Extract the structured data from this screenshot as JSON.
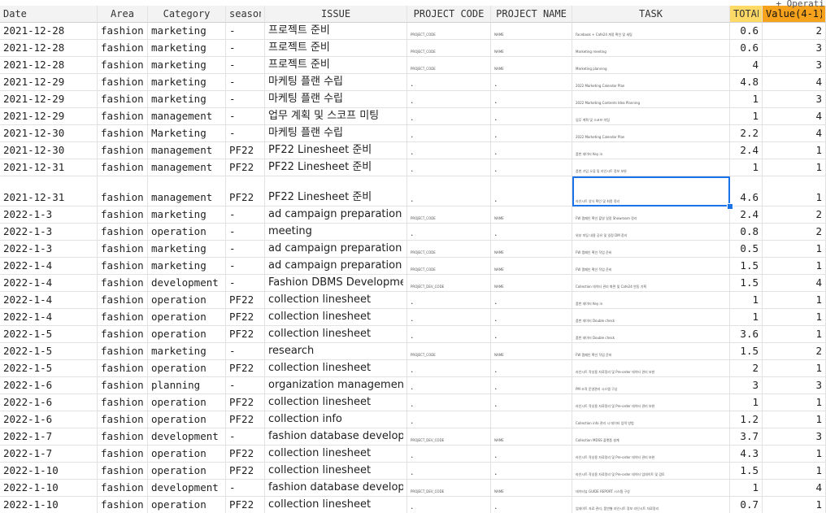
{
  "header": {
    "date": "Date",
    "area": "Area",
    "category": "Category",
    "season": "season",
    "issue": "ISSUE",
    "project_code": "PROJECT CODE",
    "project_name": "PROJECT NAME",
    "task": "TASK",
    "total": "TOTAL",
    "value": "Value(4-1)",
    "overflow": "+ Operati"
  },
  "rows": [
    {
      "date": "2021-12-28",
      "area": "fashion",
      "category": "marketing",
      "season": "-",
      "issue": "프로젝트 준비",
      "code": "PROJECT_CODE",
      "name": "NAME",
      "task": "Facebook + Cafe24 계정 확인 및 세팅",
      "total": "0.6",
      "value": "2"
    },
    {
      "date": "2021-12-28",
      "area": "fashion",
      "category": "marketing",
      "season": "-",
      "issue": "프로젝트 준비",
      "code": "PROJECT_CODE",
      "name": "NAME",
      "task": "Marketing meeting",
      "total": "0.6",
      "value": "3"
    },
    {
      "date": "2021-12-28",
      "area": "fashion",
      "category": "marketing",
      "season": "-",
      "issue": "프로젝트 준비",
      "code": "PROJECT_CODE",
      "name": "NAME",
      "task": "Marketing planning",
      "total": "4",
      "value": "3"
    },
    {
      "date": "2021-12-29",
      "area": "fashion",
      "category": "marketing",
      "season": "-",
      "issue": "마케팅 플랜 수립",
      "code": ".",
      "name": ".",
      "task": "2022 Marketing Calendar Plan",
      "total": "4.8",
      "value": "4"
    },
    {
      "date": "2021-12-29",
      "area": "fashion",
      "category": "marketing",
      "season": "-",
      "issue": "마케팅 플랜 수립",
      "code": ".",
      "name": ".",
      "task": "2022 Marketing Contents Idea Planning",
      "total": "1",
      "value": "3"
    },
    {
      "date": "2021-12-29",
      "area": "fashion",
      "category": "management",
      "season": "-",
      "issue": "업무 계획 및 스코프 미팅",
      "code": ".",
      "name": ".",
      "task": "업무 계획 및 스코프 미팅",
      "total": "1",
      "value": "4"
    },
    {
      "date": "2021-12-30",
      "area": "fashion",
      "category": "Marketing",
      "season": "-",
      "issue": "마케팅 플랜 수립",
      "code": ".",
      "name": ".",
      "task": "2022 Marketing Calendar Plan",
      "total": "2.2",
      "value": "4"
    },
    {
      "date": "2021-12-30",
      "area": "fashion",
      "category": "management",
      "season": "PF22",
      "issue": "PF22 Linesheet 준비",
      "code": ".",
      "name": ".",
      "task": "품번 데이터 Key in",
      "total": "2.4",
      "value": "1"
    },
    {
      "date": "2021-12-31",
      "area": "fashion",
      "category": "management",
      "season": "PF22",
      "issue": "PF22 Linesheet 준비",
      "code": ".",
      "name": ".",
      "task": "품번 기입 오류 및 라인시트 정보 보완",
      "total": "1",
      "value": "1"
    },
    {
      "date": "2021-12-31",
      "area": "fashion",
      "category": "management",
      "season": "PF22",
      "issue": "PF22 Linesheet 준비",
      "code": ".",
      "name": ".",
      "task": "라인시트 양식 확인 및 최종 정리",
      "total": "4.6",
      "value": "1",
      "tall": true,
      "selected": true
    },
    {
      "date": "2022-1-3",
      "area": "fashion",
      "category": "marketing",
      "season": "-",
      "issue": "ad campaign preparation",
      "code": "PROJECT_CODE",
      "name": "NAME",
      "task": "FW 캠페인 확인 촬영 일정 Showroom 정리",
      "total": "2.4",
      "value": "2"
    },
    {
      "date": "2022-1-3",
      "area": "fashion",
      "category": "operation",
      "season": "-",
      "issue": "meeting",
      "code": ".",
      "name": ".",
      "task": "외부 미팅 내용 공유 및 일정 DM 정리",
      "total": "0.8",
      "value": "2"
    },
    {
      "date": "2022-1-3",
      "area": "fashion",
      "category": "marketing",
      "season": "-",
      "issue": "ad campaign preparation",
      "code": "PROJECT_CODE",
      "name": "NAME",
      "task": "FW 캠페인 확인 작업 준비",
      "total": "0.5",
      "value": "1"
    },
    {
      "date": "2022-1-4",
      "area": "fashion",
      "category": "marketing",
      "season": "-",
      "issue": "ad campaign preparation",
      "code": "PROJECT_CODE",
      "name": "NAME",
      "task": "FW 캠페인 확인 작업 준비",
      "total": "1.5",
      "value": "1"
    },
    {
      "date": "2022-1-4",
      "area": "fashion",
      "category": "development",
      "season": "-",
      "issue": "Fashion DBMS Development",
      "code": "PROJECT_DEV_CODE",
      "name": "NAME",
      "task": "Collection 데이터 관리 화면 및 Cafe24 연동 기획",
      "total": "1.5",
      "value": "4"
    },
    {
      "date": "2022-1-4",
      "area": "fashion",
      "category": "operation",
      "season": "PF22",
      "issue": "collection linesheet",
      "code": ".",
      "name": ".",
      "task": "품번 데이터 Key in",
      "total": "1",
      "value": "1"
    },
    {
      "date": "2022-1-4",
      "area": "fashion",
      "category": "operation",
      "season": "PF22",
      "issue": "collection linesheet",
      "code": ".",
      "name": ".",
      "task": "품번 데이터 Double check",
      "total": "1",
      "value": "1"
    },
    {
      "date": "2022-1-5",
      "area": "fashion",
      "category": "operation",
      "season": "PF22",
      "issue": "collection linesheet",
      "code": ".",
      "name": ".",
      "task": "품번 데이터 Double check",
      "total": "3.6",
      "value": "1"
    },
    {
      "date": "2022-1-5",
      "area": "fashion",
      "category": "marketing",
      "season": "-",
      "issue": "research",
      "code": "PROJECT_CODE",
      "name": "NAME",
      "task": "FW 캠페인 확인 작업 준비",
      "total": "1.5",
      "value": "2"
    },
    {
      "date": "2022-1-5",
      "area": "fashion",
      "category": "operation",
      "season": "PF22",
      "issue": "collection linesheet",
      "code": ".",
      "name": ".",
      "task": "라인시트 작성용 자료정리 및 Pre-order 데이터 관리 보완",
      "total": "2",
      "value": "1"
    },
    {
      "date": "2022-1-6",
      "area": "fashion",
      "category": "planning",
      "season": "-",
      "issue": "organization management",
      "code": ".",
      "name": ".",
      "task": "PM 조직 운영관리 시스템 구상",
      "total": "3",
      "value": "3"
    },
    {
      "date": "2022-1-6",
      "area": "fashion",
      "category": "operation",
      "season": "PF22",
      "issue": "collection linesheet",
      "code": ".",
      "name": ".",
      "task": "라인시트 작성용 자료정리 및 Pre-order 데이터 관리 보완",
      "total": "1",
      "value": "1"
    },
    {
      "date": "2022-1-6",
      "area": "fashion",
      "category": "operation",
      "season": "PF22",
      "issue": "collection info",
      "code": ".",
      "name": "",
      "task": "Collection info 관리 시 데이터 입력 방법",
      "total": "1.2",
      "value": "1"
    },
    {
      "date": "2022-1-7",
      "area": "fashion",
      "category": "development",
      "season": "-",
      "issue": "fashion database development",
      "code": "PROJECT_DEV_CODE",
      "name": "NAME",
      "task": "Collection MDSS 플랫폼 설계",
      "total": "3.7",
      "value": "3"
    },
    {
      "date": "2022-1-7",
      "area": "fashion",
      "category": "operation",
      "season": "PF22",
      "issue": "collection linesheet",
      "code": ".",
      "name": ".",
      "task": "라인시트 작성용 자료정리 및 Pre-order 데이터 관리 보완",
      "total": "4.3",
      "value": "1"
    },
    {
      "date": "2022-1-10",
      "area": "fashion",
      "category": "operation",
      "season": "PF22",
      "issue": "collection linesheet",
      "code": ".",
      "name": ".",
      "task": "라인시트 작성용 자료정리 및 Pre-order 데이터 업데이트 및 검토",
      "total": "1.5",
      "value": "1"
    },
    {
      "date": "2022-1-10",
      "area": "fashion",
      "category": "development",
      "season": "-",
      "issue": "fashion database development",
      "code": "PROJECT_DEV_CODE",
      "name": "NAME",
      "task": "데이터뷰 GUIDE REPORT 시스템 구상",
      "total": "1",
      "value": "4"
    },
    {
      "date": "2022-1-10",
      "area": "fashion",
      "category": "operation",
      "season": "PF22",
      "issue": "collection linesheet",
      "code": ".",
      "name": ".",
      "task": "업데이트 자료 관리, 품번별 라인시트 정보 라인시트 자료정리",
      "total": "0.7",
      "value": "1"
    }
  ]
}
